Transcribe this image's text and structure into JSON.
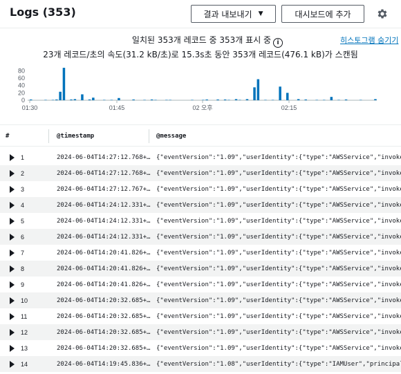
{
  "header": {
    "title": "Logs (353)",
    "export_label": "결과 내보내기",
    "dashboard_label": "대시보드에 추가"
  },
  "summary": {
    "line1": "일치된 353개 레코드 중 353개 표시 중",
    "hide_histogram": "히스토그램 숨기기",
    "line2": "23개 레코드/초의 속도(31.2 kB/초)로 15.3s초 동안 353개 레코드(476.1 kB)가 스캔됨"
  },
  "chart_data": {
    "type": "bar",
    "yticks": [
      "80",
      "60",
      "40",
      "20",
      "0"
    ],
    "ylim": [
      0,
      90
    ],
    "xticks": [
      "01:30",
      "01:45",
      "02 오후",
      "02:15"
    ],
    "series": [
      {
        "color": "#0073bb",
        "x": [
          0,
          4,
          6,
          7,
          8,
          9,
          11,
          12,
          14,
          16,
          17,
          20,
          22,
          24,
          28,
          31,
          33,
          34,
          37,
          38,
          44,
          47,
          48,
          51,
          53,
          54,
          56,
          57,
          59,
          61,
          62,
          64,
          66,
          68,
          70,
          73,
          75,
          78,
          80,
          82,
          84,
          86,
          90,
          94
        ],
        "values": [
          2,
          1,
          1,
          2,
          23,
          88,
          2,
          3,
          16,
          2,
          7,
          1,
          1,
          6,
          2,
          1,
          2,
          1,
          1,
          1,
          1,
          1,
          2,
          2,
          2,
          1,
          3,
          1,
          3,
          35,
          57,
          1,
          1,
          37,
          20,
          3,
          2,
          1,
          1,
          9,
          1,
          2,
          1,
          3
        ]
      }
    ]
  },
  "table": {
    "columns": [
      "#",
      "@timestamp",
      "@message"
    ],
    "rows": [
      {
        "num": "1",
        "ts": "2024-06-04T14:27:12.768+…",
        "msg": "{\"eventVersion\":\"1.09\",\"userIdentity\":{\"type\":\"AWSService\",\"invoke"
      },
      {
        "num": "2",
        "ts": "2024-06-04T14:27:12.768+…",
        "msg": "{\"eventVersion\":\"1.09\",\"userIdentity\":{\"type\":\"AWSService\",\"invoke"
      },
      {
        "num": "3",
        "ts": "2024-06-04T14:27:12.767+…",
        "msg": "{\"eventVersion\":\"1.09\",\"userIdentity\":{\"type\":\"AWSService\",\"invoke"
      },
      {
        "num": "4",
        "ts": "2024-06-04T14:24:12.331+…",
        "msg": "{\"eventVersion\":\"1.09\",\"userIdentity\":{\"type\":\"AWSService\",\"invoke"
      },
      {
        "num": "5",
        "ts": "2024-06-04T14:24:12.331+…",
        "msg": "{\"eventVersion\":\"1.09\",\"userIdentity\":{\"type\":\"AWSService\",\"invoke"
      },
      {
        "num": "6",
        "ts": "2024-06-04T14:24:12.331+…",
        "msg": "{\"eventVersion\":\"1.09\",\"userIdentity\":{\"type\":\"AWSService\",\"invoke"
      },
      {
        "num": "7",
        "ts": "2024-06-04T14:20:41.826+…",
        "msg": "{\"eventVersion\":\"1.09\",\"userIdentity\":{\"type\":\"AWSService\",\"invoke"
      },
      {
        "num": "8",
        "ts": "2024-06-04T14:20:41.826+…",
        "msg": "{\"eventVersion\":\"1.09\",\"userIdentity\":{\"type\":\"AWSService\",\"invoke"
      },
      {
        "num": "9",
        "ts": "2024-06-04T14:20:41.826+…",
        "msg": "{\"eventVersion\":\"1.09\",\"userIdentity\":{\"type\":\"AWSService\",\"invoke"
      },
      {
        "num": "10",
        "ts": "2024-06-04T14:20:32.685+…",
        "msg": "{\"eventVersion\":\"1.09\",\"userIdentity\":{\"type\":\"AWSService\",\"invoke"
      },
      {
        "num": "11",
        "ts": "2024-06-04T14:20:32.685+…",
        "msg": "{\"eventVersion\":\"1.09\",\"userIdentity\":{\"type\":\"AWSService\",\"invoke"
      },
      {
        "num": "12",
        "ts": "2024-06-04T14:20:32.685+…",
        "msg": "{\"eventVersion\":\"1.09\",\"userIdentity\":{\"type\":\"AWSService\",\"invoke"
      },
      {
        "num": "13",
        "ts": "2024-06-04T14:20:32.685+…",
        "msg": "{\"eventVersion\":\"1.09\",\"userIdentity\":{\"type\":\"AWSService\",\"invoke"
      },
      {
        "num": "14",
        "ts": "2024-06-04T14:19:45.836+…",
        "msg": "{\"eventVersion\":\"1.08\",\"userIdentity\":{\"type\":\"IAMUser\",\"principal"
      }
    ]
  }
}
